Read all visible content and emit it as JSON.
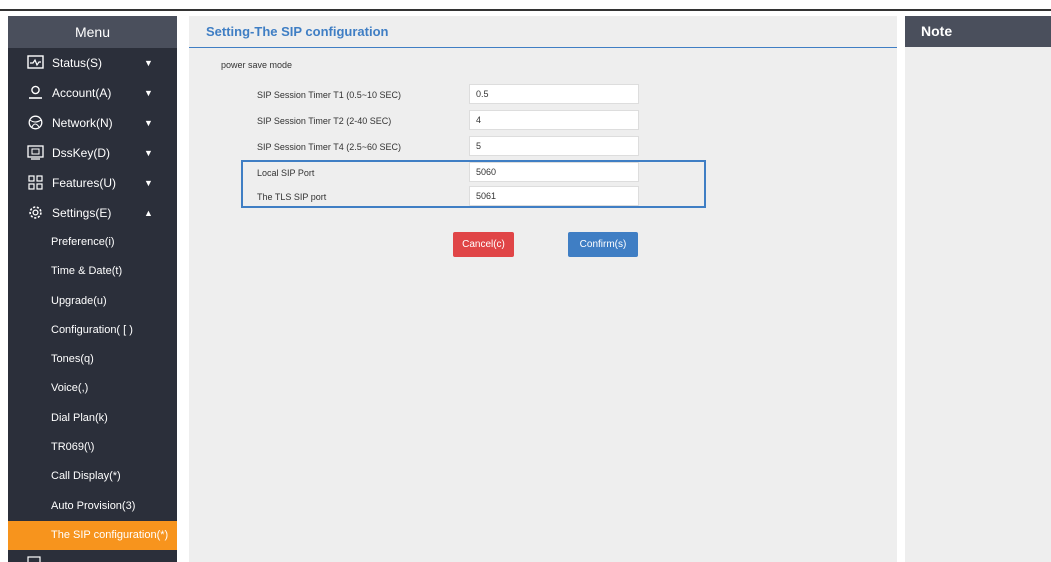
{
  "sidebar": {
    "title": "Menu",
    "items": [
      {
        "label": "Status(S)",
        "icon": "status-icon",
        "expanded": false
      },
      {
        "label": "Account(A)",
        "icon": "account-icon",
        "expanded": false
      },
      {
        "label": "Network(N)",
        "icon": "network-icon",
        "expanded": false
      },
      {
        "label": "DssKey(D)",
        "icon": "dsskey-icon",
        "expanded": false
      },
      {
        "label": "Features(U)",
        "icon": "features-icon",
        "expanded": false
      },
      {
        "label": "Settings(E)",
        "icon": "gear-icon",
        "expanded": true
      }
    ],
    "sub_items": [
      {
        "label": "Preference(i)"
      },
      {
        "label": "Time & Date(t)"
      },
      {
        "label": "Upgrade(u)"
      },
      {
        "label": "Configuration( [ )"
      },
      {
        "label": "Tones(q)"
      },
      {
        "label": "Voice(,)"
      },
      {
        "label": "Dial Plan(k)"
      },
      {
        "label": "TR069(\\)"
      },
      {
        "label": "Call Display(*)"
      },
      {
        "label": "Auto Provision(3)"
      },
      {
        "label": "The SIP configuration(*)",
        "active": true
      }
    ]
  },
  "main": {
    "title": "Setting-The SIP configuration",
    "section_label": "power save mode",
    "fields": [
      {
        "label": "SIP Session Timer T1 (0.5~10 SEC)",
        "value": "0.5"
      },
      {
        "label": "SIP Session Timer T2 (2-40 SEC)",
        "value": "4"
      },
      {
        "label": "SIP Session Timer T4 (2.5~60 SEC)",
        "value": "5"
      },
      {
        "label": "Local SIP Port",
        "value": "5060"
      },
      {
        "label": "The TLS SIP port",
        "value": "5061"
      }
    ],
    "buttons": {
      "cancel": "Cancel(c)",
      "confirm": "Confirm(s)"
    }
  },
  "note": {
    "title": "Note"
  },
  "colors": {
    "accent": "#3f7ec4",
    "active_item": "#f7941d",
    "sidebar_bg": "#2b2f3a",
    "header_bg": "#4a4f5c",
    "cancel": "#e04547"
  }
}
